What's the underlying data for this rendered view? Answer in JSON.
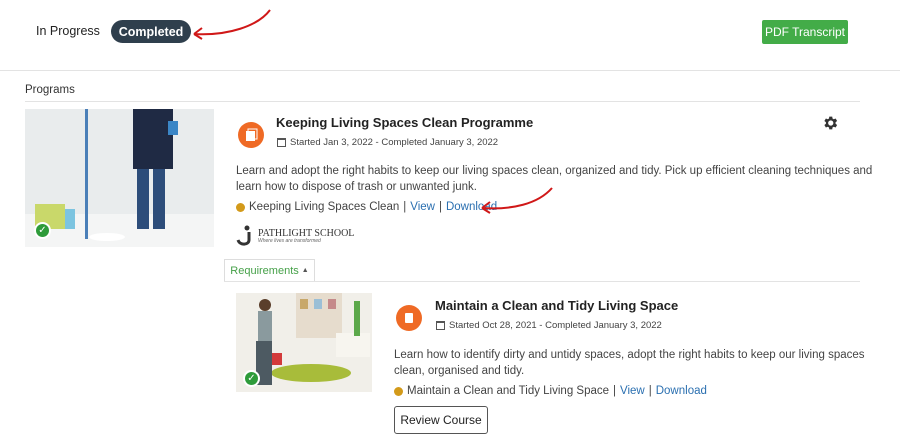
{
  "tabs": {
    "in_progress": "In Progress",
    "completed": "Completed"
  },
  "pdf_transcript": "PDF Transcript",
  "section_title": "Programs",
  "program": {
    "title": "Keeping Living Spaces Clean Programme",
    "dates": "Started Jan 3, 2022 - Completed January 3, 2022",
    "description_line1": "Learn and adopt the right habits to keep our living spaces clean, organized and tidy. Pick up efficient cleaning techniques and",
    "description_line2": "learn how to dispose of trash or unwanted junk.",
    "certificate": "Keeping Living Spaces Clean",
    "sep": "|",
    "view": "View",
    "download": "Download",
    "logo_name": "PATHLIGHT SCHOOL",
    "logo_tagline": "Where lives are transformed"
  },
  "requirements_label": "Requirements",
  "course": {
    "title": "Maintain a Clean and Tidy Living Space",
    "dates": "Started Oct 28, 2021 - Completed January 3, 2022",
    "description_line1": "Learn how to identify dirty and untidy spaces, adopt the right habits to keep our living spaces",
    "description_line2": "clean, organised and tidy.",
    "certificate": "Maintain a Clean and Tidy Living Space",
    "sep": "|",
    "view": "View",
    "download": "Download",
    "review": "Review Course"
  },
  "colors": {
    "accent_green": "#43ac48",
    "tab_dark": "#2f3f4d",
    "icon_orange": "#ef6a25",
    "link_blue": "#2a6fb0",
    "annotation_red": "#d01818"
  }
}
